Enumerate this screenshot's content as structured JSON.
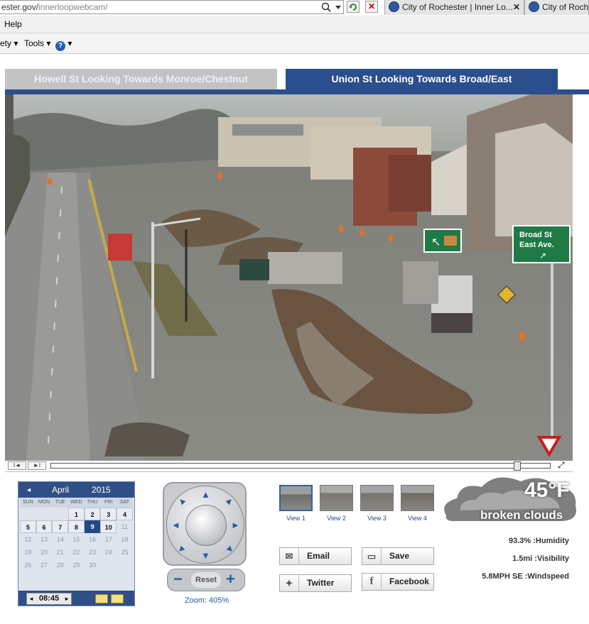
{
  "browser": {
    "url_prefix": "ester.gov/",
    "url_path": "innerloopwebcam/",
    "tabs": [
      {
        "label": "City of Rochester | Inner Lo..."
      },
      {
        "label": "City of Roche"
      }
    ],
    "menu": {
      "help": "Help"
    },
    "commands": {
      "safety": "ety ▾",
      "tools": "Tools ▾",
      "help_caret": "▾"
    }
  },
  "camera_tabs": [
    {
      "label": "Howell St Looking Towards Monroe/Chestnut",
      "active": false
    },
    {
      "label": "Union St Looking Towards Broad/East",
      "active": true
    }
  ],
  "webcam": {
    "sign_left": "↖",
    "sign_right_line1": "Broad St",
    "sign_right_line2": "East Ave.",
    "sign_right_arrow": "↗"
  },
  "player": {
    "prev": "I◄",
    "next": "►I",
    "fullscreen": "⤢"
  },
  "calendar": {
    "month": "April",
    "year": "2015",
    "prev": "◄",
    "days_of_week": [
      "SUN",
      "MON",
      "TUE",
      "WED",
      "THU",
      "FRI",
      "SAT"
    ],
    "weeks": [
      [
        "",
        "",
        "",
        "1",
        "2",
        "3",
        "4"
      ],
      [
        "5",
        "6",
        "7",
        "8",
        "9",
        "10",
        "11"
      ],
      [
        "12",
        "13",
        "14",
        "15",
        "16",
        "17",
        "18"
      ],
      [
        "19",
        "20",
        "21",
        "22",
        "23",
        "24",
        "25"
      ],
      [
        "26",
        "27",
        "28",
        "29",
        "30",
        "",
        ""
      ]
    ],
    "available_days": [
      "1",
      "2",
      "3",
      "4",
      "5",
      "6",
      "7",
      "8",
      "9",
      "10"
    ],
    "selected_day": "9",
    "time": "08:45",
    "time_prev": "◄",
    "time_next": "►"
  },
  "ptz": {
    "reset_label": "Reset",
    "zoom_out": "−",
    "zoom_in": "+",
    "zoom_text": "Zoom: 405%"
  },
  "views": [
    {
      "label": "View 1"
    },
    {
      "label": "View 2"
    },
    {
      "label": "View 3"
    },
    {
      "label": "View 4"
    }
  ],
  "share": {
    "email": "Email",
    "save": "Save",
    "twitter": "Twitter",
    "facebook": "Facebook"
  },
  "weather": {
    "temperature": "45°F",
    "condition": "broken clouds",
    "humidity_value": "93.3%",
    "humidity_label": ":Humidity",
    "visibility_value": "1.5mi",
    "visibility_label": ":Visibility",
    "wind_value": "5.8MPH SE",
    "wind_label": ":Windspeed"
  },
  "colors": {
    "active_tab": "#2b4e8c",
    "inactive_tab": "#c3c3c3",
    "sign_green": "#1f7a45",
    "zoom_text": "#2a5aa0"
  }
}
